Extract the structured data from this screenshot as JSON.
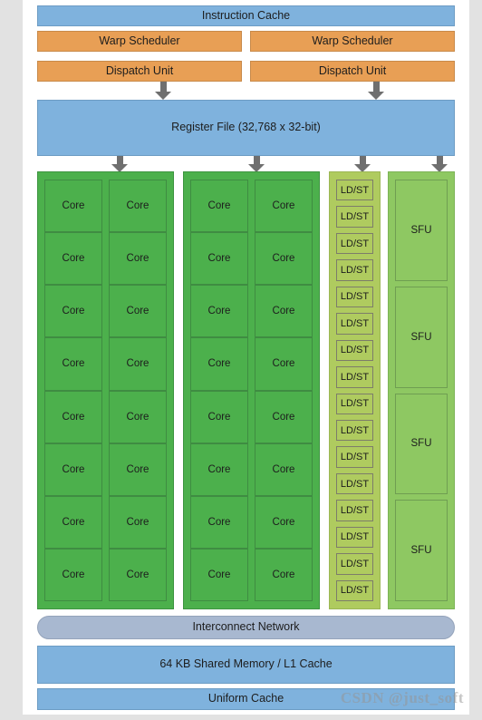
{
  "diagram": {
    "type": "gpu-streaming-multiprocessor-block-diagram",
    "instruction_cache": "Instruction Cache",
    "schedulers": [
      {
        "warp_scheduler": "Warp Scheduler",
        "dispatch_unit": "Dispatch Unit"
      },
      {
        "warp_scheduler": "Warp Scheduler",
        "dispatch_unit": "Dispatch Unit"
      }
    ],
    "register_file": "Register File (32,768 x 32-bit)",
    "columns": [
      {
        "kind": "core",
        "label": "Core",
        "rows": 8,
        "per_row": 2,
        "count": 16
      },
      {
        "kind": "core",
        "label": "Core",
        "rows": 8,
        "per_row": 2,
        "count": 16
      },
      {
        "kind": "ldst",
        "label": "LD/ST",
        "count": 16
      },
      {
        "kind": "sfu",
        "label": "SFU",
        "count": 4
      }
    ],
    "interconnect": "Interconnect Network",
    "shared_memory": "64 KB Shared Memory / L1 Cache",
    "uniform_cache": "Uniform Cache",
    "watermark": "CSDN @just_soft"
  },
  "colors": {
    "blue": "#7fb2dd",
    "orange": "#e89f55",
    "core_green": "#4cb04c",
    "ldst_green": "#afcb5f",
    "sfu_green": "#8ec862",
    "lavender": "#a8b8d0",
    "arrow_gray": "#6f6f6f",
    "page_background": "#e2e2e2",
    "card_background": "#ffffff"
  }
}
